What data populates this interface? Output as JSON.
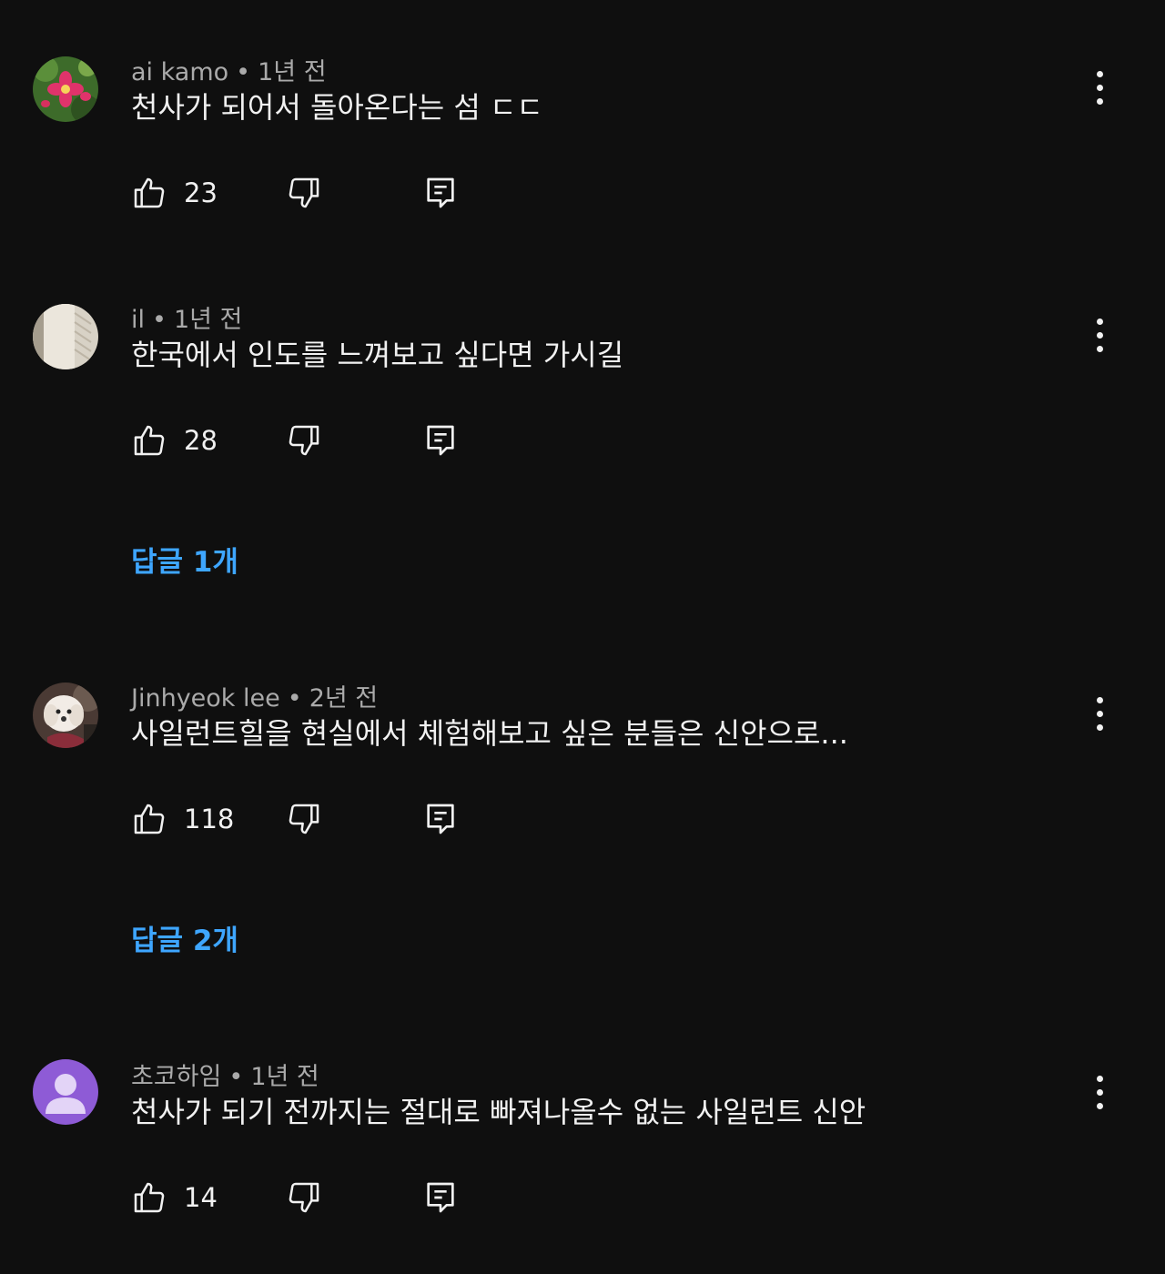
{
  "colors": {
    "background": "#0f0f0f",
    "text_primary": "#f1f1f1",
    "text_secondary": "#aaaaaa",
    "link_blue": "#3ea6ff",
    "default_avatar": "#8e5bd6"
  },
  "icons": {
    "like": "thumbs-up-icon",
    "dislike": "thumbs-down-icon",
    "reply": "comment-reply-icon",
    "more": "vertical-dots-icon"
  },
  "comments": [
    {
      "author": "ai kamo",
      "time": "1년 전",
      "text": "천사가 되어서 돌아온다는 섬 ㄷㄷ",
      "likes": "23",
      "replies_label": ""
    },
    {
      "author": "il",
      "time": "1년 전",
      "text": "한국에서 인도를 느껴보고 싶다면 가시길",
      "likes": "28",
      "replies_label": "답글 1개"
    },
    {
      "author": "Jinhyeok lee",
      "time": "2년 전",
      "text": "사일런트힐을 현실에서 체험해보고 싶은 분들은 신안으로...",
      "likes": "118",
      "replies_label": "답글 2개"
    },
    {
      "author": "초코하임",
      "time": "1년 전",
      "text": "천사가 되기 전까지는 절대로 빠져나올수 없는 사일런트 신안",
      "likes": "14",
      "replies_label": ""
    }
  ]
}
